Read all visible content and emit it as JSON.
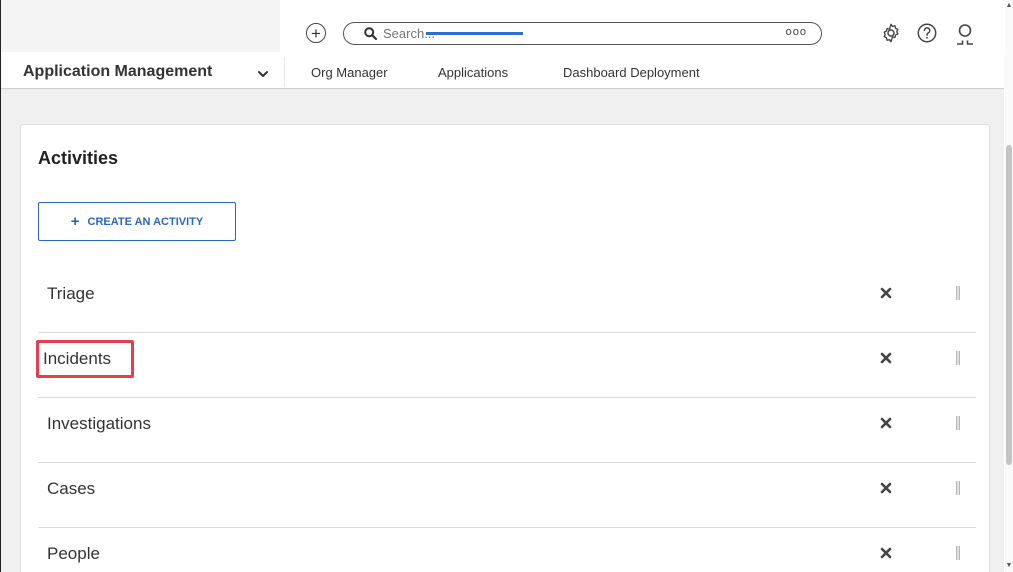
{
  "header": {
    "search_placeholder": "Search...",
    "more_label": "ooo",
    "icons": [
      "add-icon",
      "search-icon",
      "settings-icon",
      "help-icon",
      "user-icon"
    ]
  },
  "nav": {
    "app_selector": "Application Management",
    "tabs": [
      {
        "label": "Org Manager"
      },
      {
        "label": "Applications",
        "active": true
      },
      {
        "label": "Dashboard Deployment"
      }
    ]
  },
  "page": {
    "title": "Activities",
    "create_button": "CREATE AN ACTIVITY",
    "activities": [
      {
        "label": "Triage"
      },
      {
        "label": "Incidents",
        "highlighted": true
      },
      {
        "label": "Investigations"
      },
      {
        "label": "Cases"
      },
      {
        "label": "People"
      }
    ]
  },
  "colors": {
    "accent": "#2a6fd1",
    "highlight": "#e2414b"
  }
}
